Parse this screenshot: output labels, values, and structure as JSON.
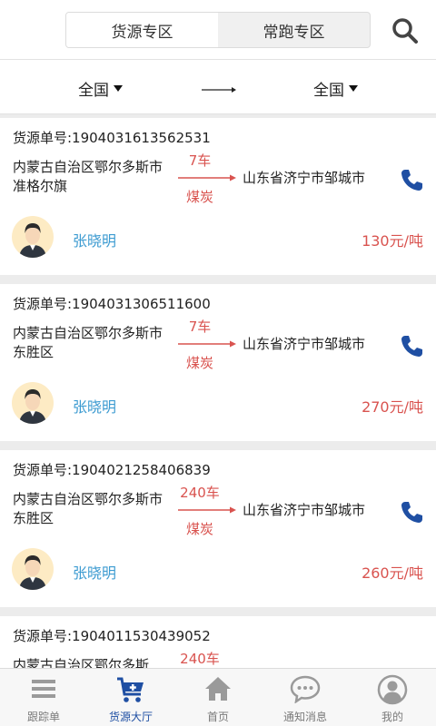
{
  "header": {
    "tabs": [
      {
        "label": "货源专区",
        "active": true
      },
      {
        "label": "常跑专区",
        "active": false
      }
    ]
  },
  "filter": {
    "from_label": "全国",
    "to_label": "全国"
  },
  "cards": [
    {
      "no": "货源单号:1904031613562531",
      "from": "内蒙古自治区鄂尔多斯市准格尔旗",
      "trucks": "7车",
      "cargo": "煤炭",
      "to": "山东省济宁市邹城市",
      "name": "张晓明",
      "price": "130元/吨"
    },
    {
      "no": "货源单号:1904031306511600",
      "from": "内蒙古自治区鄂尔多斯市东胜区",
      "trucks": "7车",
      "cargo": "煤炭",
      "to": "山东省济宁市邹城市",
      "name": "张晓明",
      "price": "270元/吨"
    },
    {
      "no": "货源单号:1904021258406839",
      "from": "内蒙古自治区鄂尔多斯市东胜区",
      "trucks": "240车",
      "cargo": "煤炭",
      "to": "山东省济宁市邹城市",
      "name": "张晓明",
      "price": "260元/吨"
    },
    {
      "no": "货源单号:1904011530439052",
      "from": "内蒙古自治区鄂尔多斯",
      "trucks": "240车",
      "cargo": "",
      "to": "",
      "name": "",
      "price": ""
    }
  ],
  "tabbar": [
    {
      "label": "跟踪单",
      "icon": "list-icon",
      "active": false
    },
    {
      "label": "货源大厅",
      "icon": "cart-plus-icon",
      "active": true
    },
    {
      "label": "首页",
      "icon": "home-icon",
      "active": false
    },
    {
      "label": "通知消息",
      "icon": "chat-icon",
      "active": false
    },
    {
      "label": "我的",
      "icon": "user-icon",
      "active": false
    }
  ],
  "colors": {
    "accent_red": "#d9534f",
    "name_blue": "#3d9bd1",
    "active_tab": "#1f4fa3",
    "phone_blue": "#1f4fa3"
  }
}
